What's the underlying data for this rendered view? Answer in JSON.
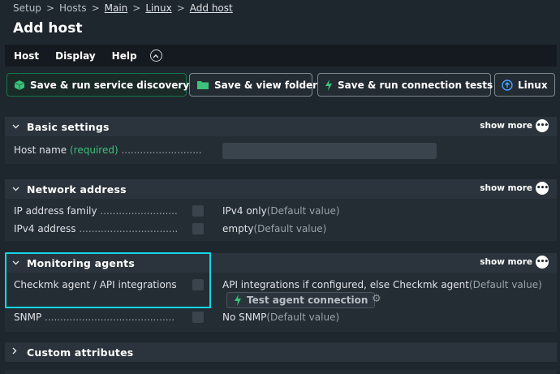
{
  "breadcrumb": {
    "setup": "Setup",
    "hosts": "Hosts",
    "main": "Main",
    "linux": "Linux",
    "add_host": "Add host",
    "separator": ">"
  },
  "page_title": "Add host",
  "menu": {
    "host": "Host",
    "display": "Display",
    "help": "Help",
    "collapse_icon": "chevron-up-circle-icon"
  },
  "toolbar": {
    "save_discovery": "Save & run service discovery",
    "save_folder": "Save & view folder",
    "save_tests": "Save & run connection tests",
    "linux": "Linux"
  },
  "colors": {
    "accent_green": "#3cc27a",
    "highlight": "#12d6e6",
    "background": "#1e262e"
  },
  "sections": {
    "basic": {
      "title": "Basic settings",
      "show_more": "show more",
      "host_name_label": "Host name",
      "host_name_required": "(required)",
      "host_name_dots": "..........................",
      "host_name_value": ""
    },
    "network": {
      "title": "Network address",
      "show_more": "show more",
      "ip_family_label": "IP address family",
      "ip_family_dots": ".........................",
      "ip_family_value": "IPv4 only",
      "ip_family_default": "(Default value)",
      "ipv4_label": "IPv4 address",
      "ipv4_dots": "................................",
      "ipv4_value": "empty",
      "ipv4_default": "(Default value)"
    },
    "monitoring": {
      "title": "Monitoring agents",
      "show_more": "show more",
      "agent_label": "Checkmk agent / API integrations",
      "agent_value": "API integrations if configured, else Checkmk agent",
      "agent_default": "(Default value)",
      "test_button": "Test agent connection",
      "snmp_label": "SNMP",
      "snmp_dots": "..........................................",
      "snmp_value": "No SNMP",
      "snmp_default": "(Default value)"
    },
    "custom": {
      "title": "Custom attributes"
    }
  }
}
